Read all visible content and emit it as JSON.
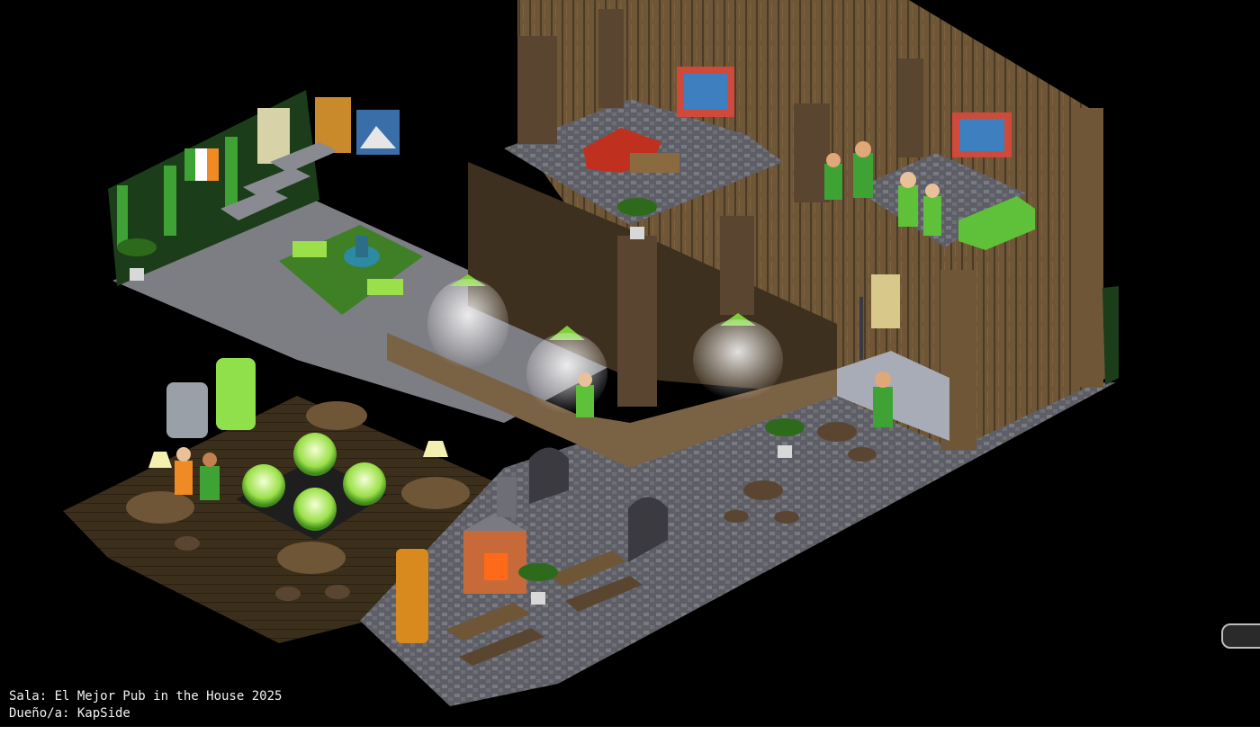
{
  "room": {
    "name_line": "Sala: El Mejor Pub in the House 2025",
    "owner_line": "Dueño/a: KapSide"
  },
  "colors": {
    "background": "#000000",
    "wood_dark": "#4a3a26",
    "wood_mid": "#6e5637",
    "wood_light": "#8c7048",
    "stone": "#6b6b72",
    "floor_grey": "#7d7d84",
    "floor_wood": "#3b2f1c",
    "accent_green": "#5fc13a",
    "lamp_glow": "#e8f5b8",
    "irish_orange": "#f08a24"
  },
  "icons": [
    "side-panel-tab-icon"
  ]
}
